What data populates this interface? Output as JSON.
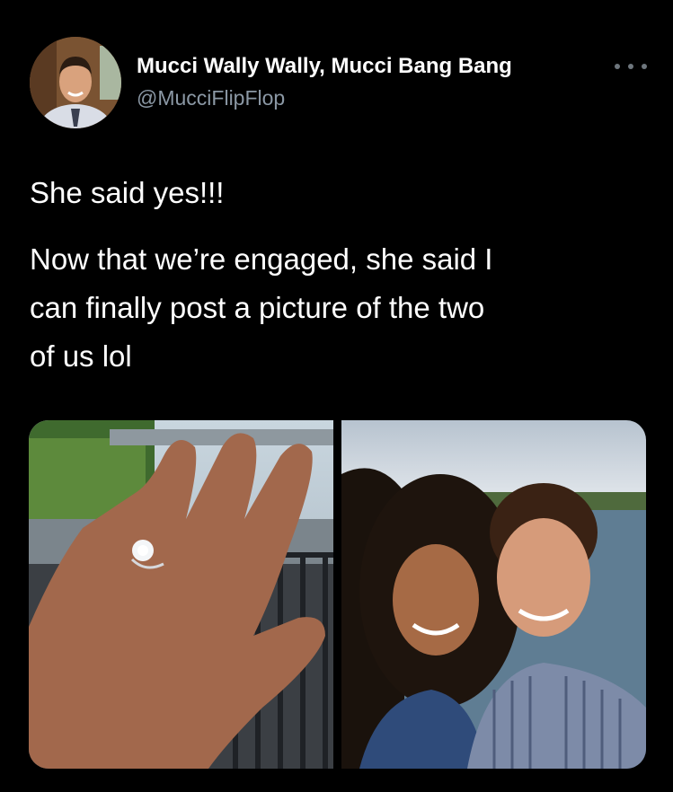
{
  "tweet": {
    "author_name": "Mucci Wally Wally, Mucci Bang Bang",
    "author_handle": "@MucciFlipFlop",
    "avatar_icon": "profile-photo",
    "more_icon": "more-horizontal-icon",
    "lines": [
      "She said yes!!!",
      "Now that we’re engaged, she said I",
      "can finally post a picture of the two",
      "of us lol"
    ]
  },
  "media": {
    "photos": [
      {
        "subject": "hand-with-engagement-ring-photo"
      },
      {
        "subject": "couple-selfie-photo"
      }
    ]
  },
  "colors": {
    "background": "#000000",
    "text_primary": "#ffffff",
    "text_secondary": "#8b98a5",
    "icon_muted": "#6e767d"
  }
}
